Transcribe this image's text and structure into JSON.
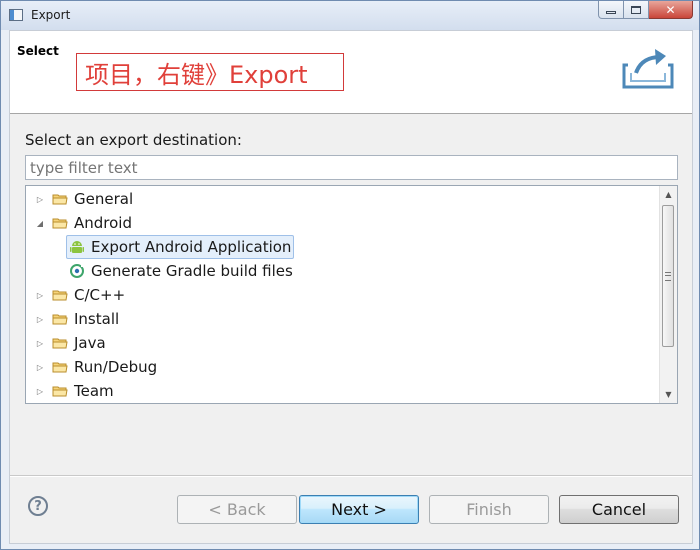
{
  "window": {
    "title": "Export"
  },
  "header": {
    "title": "Select",
    "annotation": "项目，右键》Export"
  },
  "main": {
    "destination_label": "Select an export destination:",
    "filter_placeholder": "type filter text",
    "tree": [
      {
        "label": "General",
        "expanded": false,
        "type": "folder"
      },
      {
        "label": "Android",
        "expanded": true,
        "type": "folder"
      },
      {
        "label": "Export Android Application",
        "type": "android-leaf",
        "selected": true
      },
      {
        "label": "Generate Gradle build files",
        "type": "gradle-leaf"
      },
      {
        "label": "C/C++",
        "expanded": false,
        "type": "folder"
      },
      {
        "label": "Install",
        "expanded": false,
        "type": "folder"
      },
      {
        "label": "Java",
        "expanded": false,
        "type": "folder"
      },
      {
        "label": "Run/Debug",
        "expanded": false,
        "type": "folder"
      },
      {
        "label": "Team",
        "expanded": false,
        "type": "folder"
      }
    ]
  },
  "footer": {
    "back_label": "< Back",
    "next_label": "Next >",
    "finish_label": "Finish",
    "cancel_label": "Cancel",
    "help_symbol": "?"
  },
  "icons": {
    "help": "help-icon",
    "export": "export-icon",
    "folder": "folder-icon",
    "android": "android-icon",
    "gradle": "gradle-icon"
  },
  "colors": {
    "annotation": "#e0403a",
    "selection": "#e4effb",
    "default_button": "#bee6fd"
  }
}
